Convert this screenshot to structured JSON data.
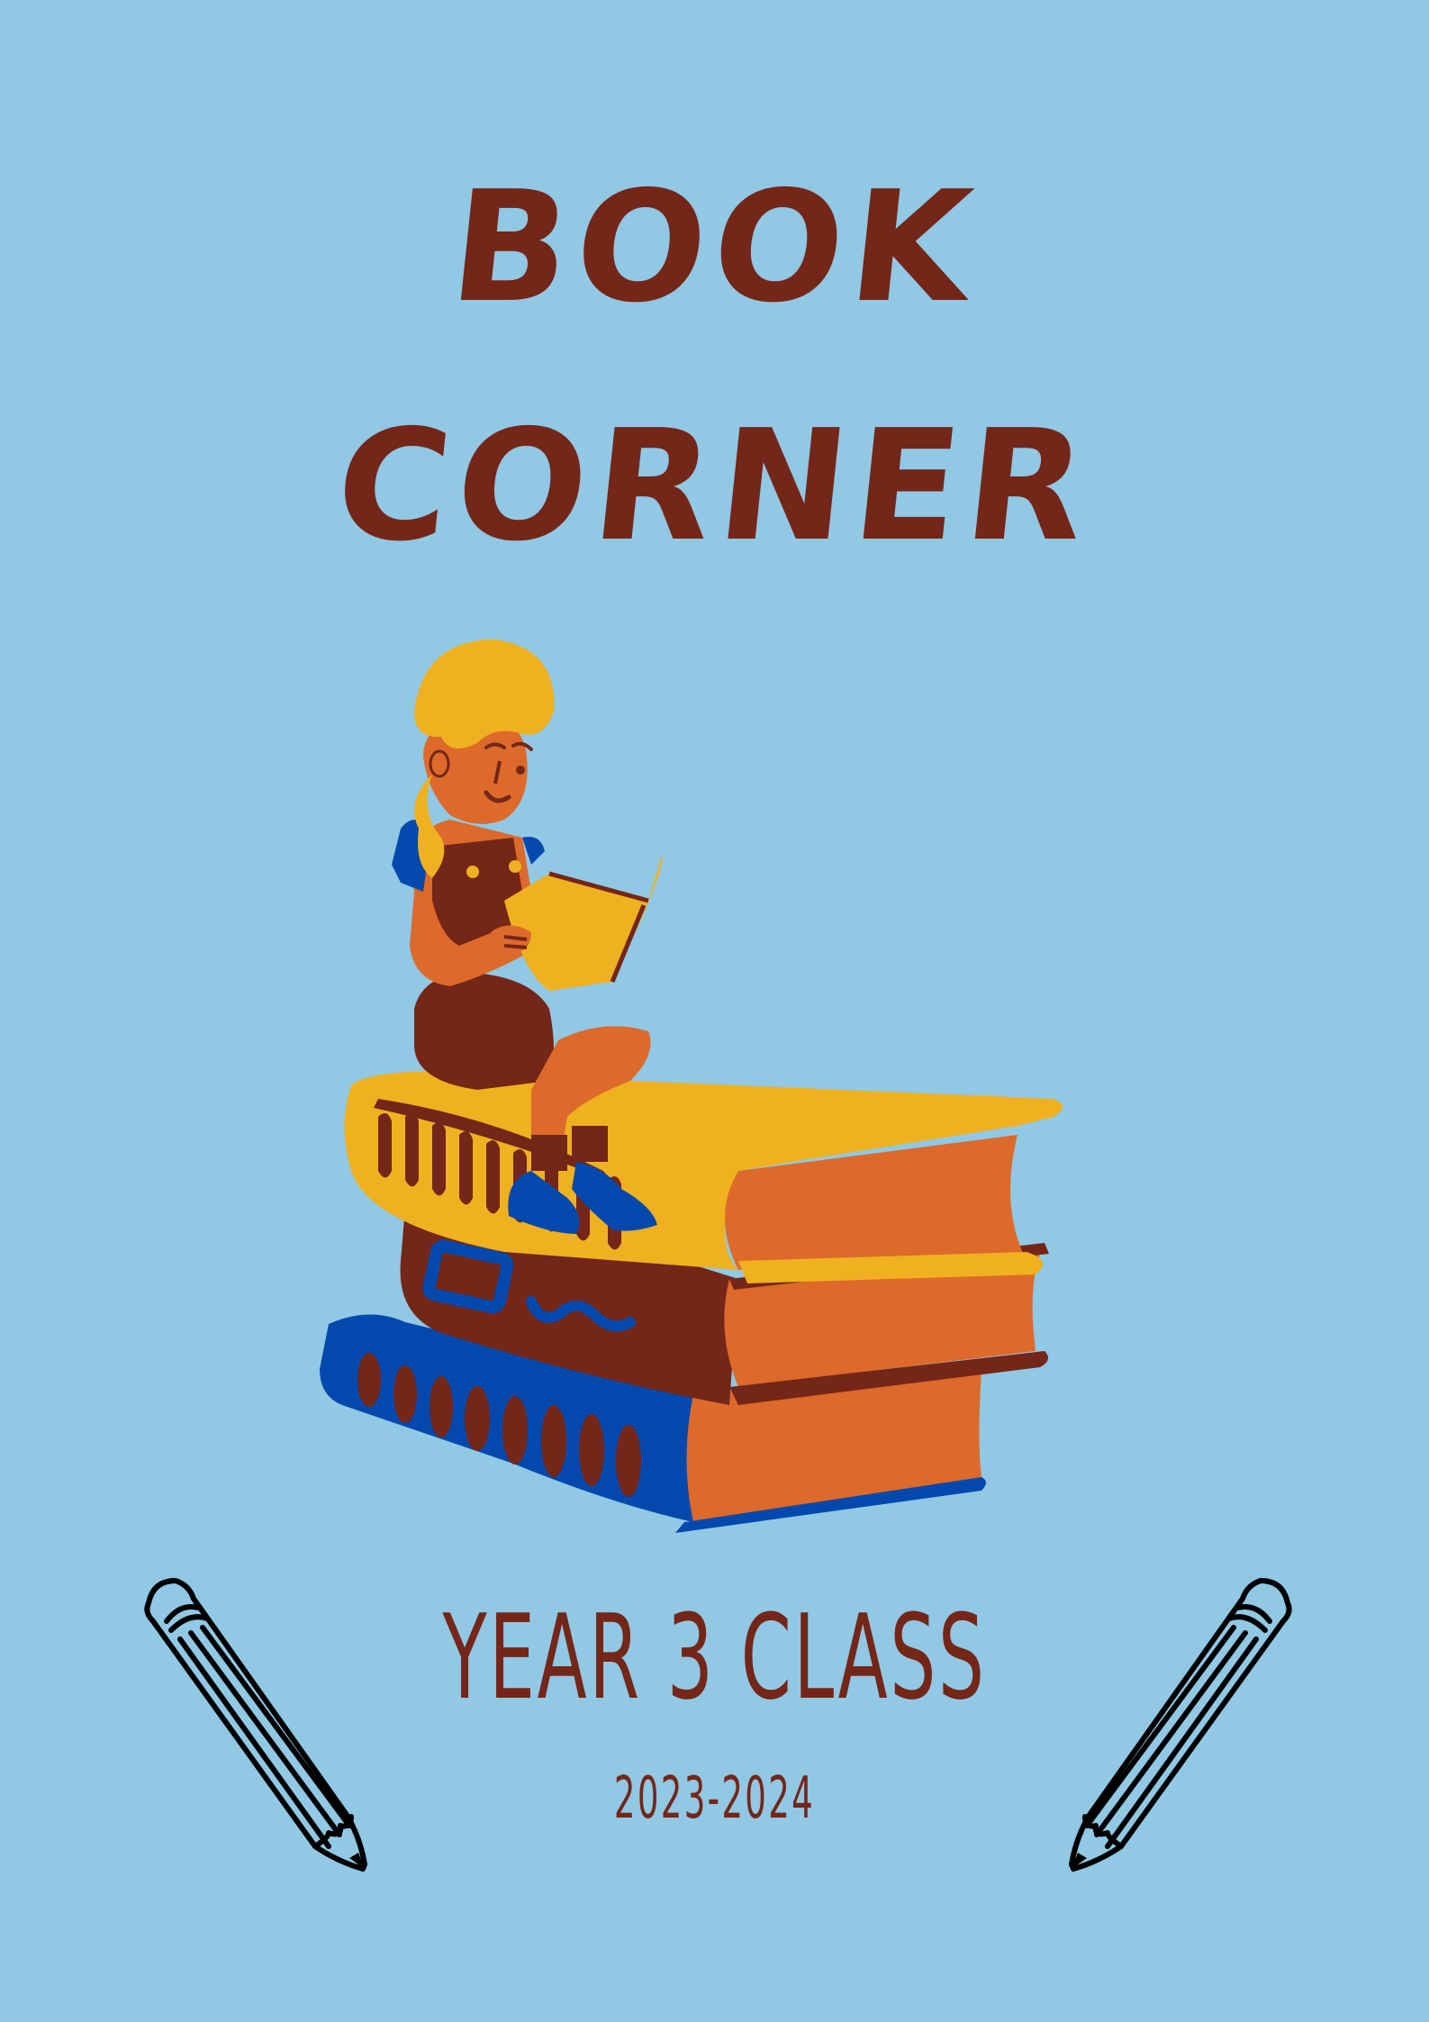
{
  "title": {
    "line1": "BOOK",
    "line2": "CORNER"
  },
  "class_name": "YEAR 3 CLASS",
  "school_year": "2023-2024",
  "illustration": {
    "icon": "child-reading-on-books-icon"
  },
  "pencils": {
    "left_icon": "pencil-icon",
    "right_icon": "pencil-icon"
  },
  "colors": {
    "background": "#91c8e4",
    "title": "#742618",
    "yellow": "#efb120",
    "orange": "#dd6a2a",
    "brown": "#742618",
    "blue": "#0349ad"
  }
}
